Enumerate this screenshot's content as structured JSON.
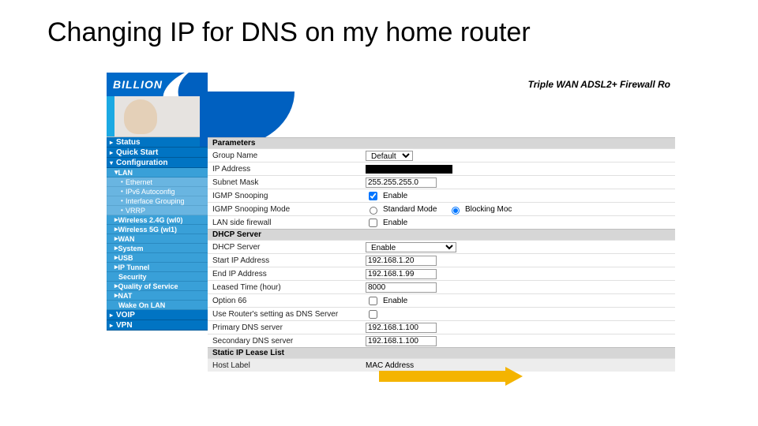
{
  "slide_title": "Changing IP for DNS on my home router",
  "brand": "BILLION",
  "product": "Triple WAN ADSL2+ Firewall Ro",
  "nav": {
    "status": "Status",
    "quick_start": "Quick Start",
    "configuration": "Configuration",
    "lan": "LAN",
    "ethernet": "Ethernet",
    "ipv6": "IPv6 Autoconfig",
    "if_group": "Interface Grouping",
    "vrrp": "VRRP",
    "w24": "Wireless 2.4G (wl0)",
    "w5": "Wireless 5G (wl1)",
    "wan": "WAN",
    "system": "System",
    "usb": "USB",
    "iptunnel": "IP Tunnel",
    "security": "Security",
    "qos": "Quality of Service",
    "nat": "NAT",
    "wol": "Wake On LAN",
    "voip": "VOIP",
    "vpn": "VPN"
  },
  "sections": {
    "parameters": "Parameters",
    "dhcp": "DHCP Server",
    "static": "Static IP Lease List"
  },
  "labels": {
    "group_name": "Group Name",
    "ip_address": "IP Address",
    "subnet": "Subnet Mask",
    "igmp_snoop": "IGMP Snooping",
    "igmp_mode": "IGMP Snooping Mode",
    "mode_std": "Standard Mode",
    "mode_block": "Blocking Moc",
    "lan_fw": "LAN side firewall",
    "dhcp_server": "DHCP Server",
    "start_ip": "Start IP Address",
    "end_ip": "End IP Address",
    "lease": "Leased Time (hour)",
    "opt66": "Option 66",
    "use_router_dns": "Use Router's setting as DNS Server",
    "primary_dns": "Primary DNS server",
    "secondary_dns": "Secondary DNS server",
    "host_label": "Host Label",
    "mac": "MAC Address",
    "enable": "Enable"
  },
  "values": {
    "group_name": "Default",
    "subnet": "255.255.255.0",
    "dhcp_server": "Enable",
    "start_ip": "192.168.1.20",
    "end_ip": "192.168.1.99",
    "lease": "8000",
    "primary_dns": "192.168.1.100",
    "secondary_dns": "192.168.1.100"
  }
}
